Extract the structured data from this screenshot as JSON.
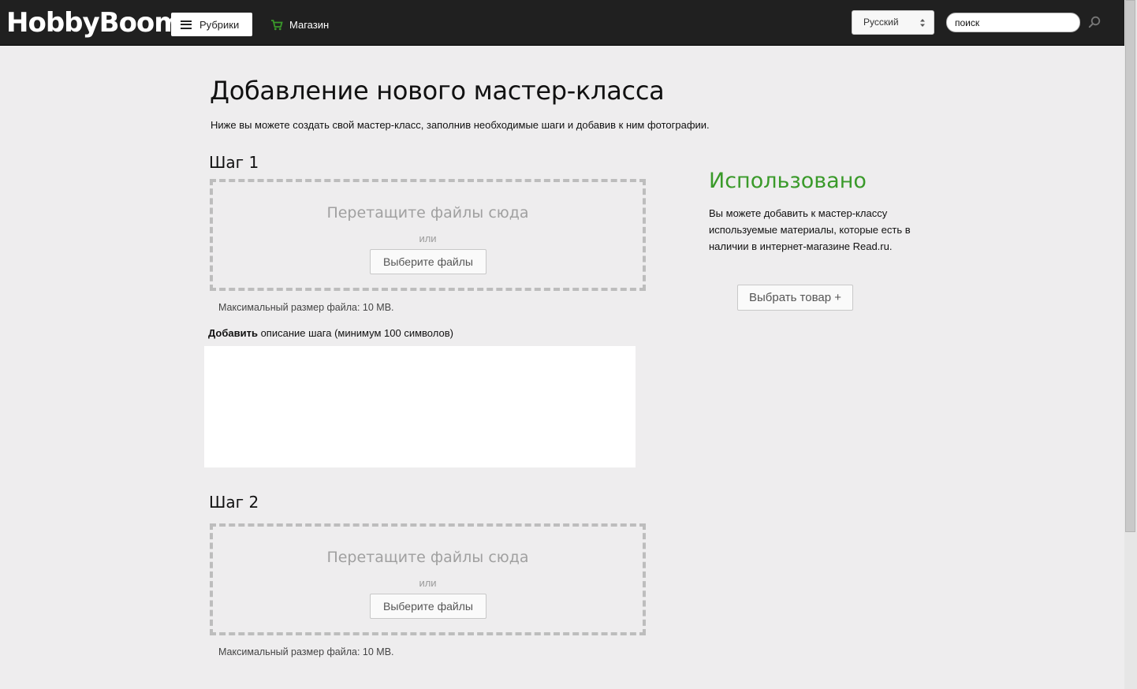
{
  "header": {
    "logo": "HobbyBoom",
    "rubrics_label": "Рубрики",
    "shop_label": "Магазин",
    "language": "Русский",
    "search_value": "поиск",
    "accent_color": "#3a9a2a"
  },
  "page": {
    "title": "Добавление нового мастер-класса",
    "subtitle": "Ниже вы можете создать свой мастер-класс, заполнив необходимые шаги и добавив к ним фотографии."
  },
  "steps": [
    {
      "title": "Шаг 1",
      "drop_title": "Перетащите файлы сюда",
      "drop_or": "или",
      "choose_files": "Выберите файлы",
      "max_size": "Максимальный размер файла: 10 MB."
    },
    {
      "title": "Шаг 2",
      "drop_title": "Перетащите файлы сюда",
      "drop_or": "или",
      "choose_files": "Выберите файлы",
      "max_size": "Максимальный размер файла: 10 MB."
    }
  ],
  "description": {
    "label_bold": "Добавить",
    "label_rest": " описание шага (минимум 100 символов)",
    "value": ""
  },
  "sidebar": {
    "title": "Использовано",
    "text": "Вы можете добавить к мастер-классу используемые материалы, которые есть в наличии в интернет-магазине Read.ru.",
    "button": "Выбрать товар +"
  }
}
